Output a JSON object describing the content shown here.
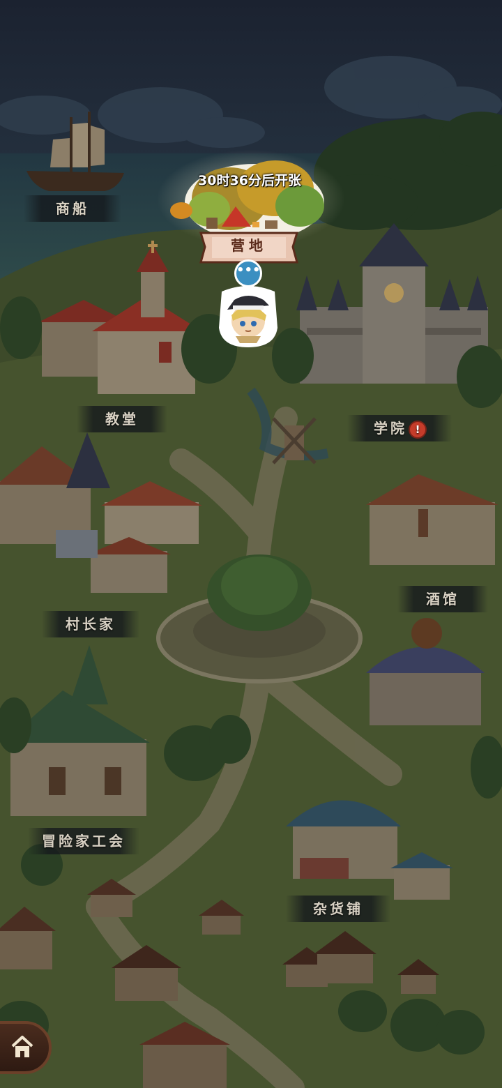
{
  "campsite": {
    "timer": "30时36分后开张",
    "name": "营地"
  },
  "speech_bubble": "•••",
  "locations": {
    "merchant_ship": "商船",
    "church": "教堂",
    "academy": "学院",
    "academy_alert": "!",
    "tavern": "酒馆",
    "chief_house": "村长家",
    "adventurer_guild": "冒险家工会",
    "general_store": "杂货铺"
  },
  "icons": {
    "home": "home-icon",
    "speech": "speech-bubble-icon"
  },
  "colors": {
    "night_sky": "#1b2230",
    "label_bg": "#14181c",
    "label_text": "#d9d2c4",
    "alert": "#c53c2a",
    "bubble": "#3b8fc1",
    "banner": "#e8c4b0"
  }
}
